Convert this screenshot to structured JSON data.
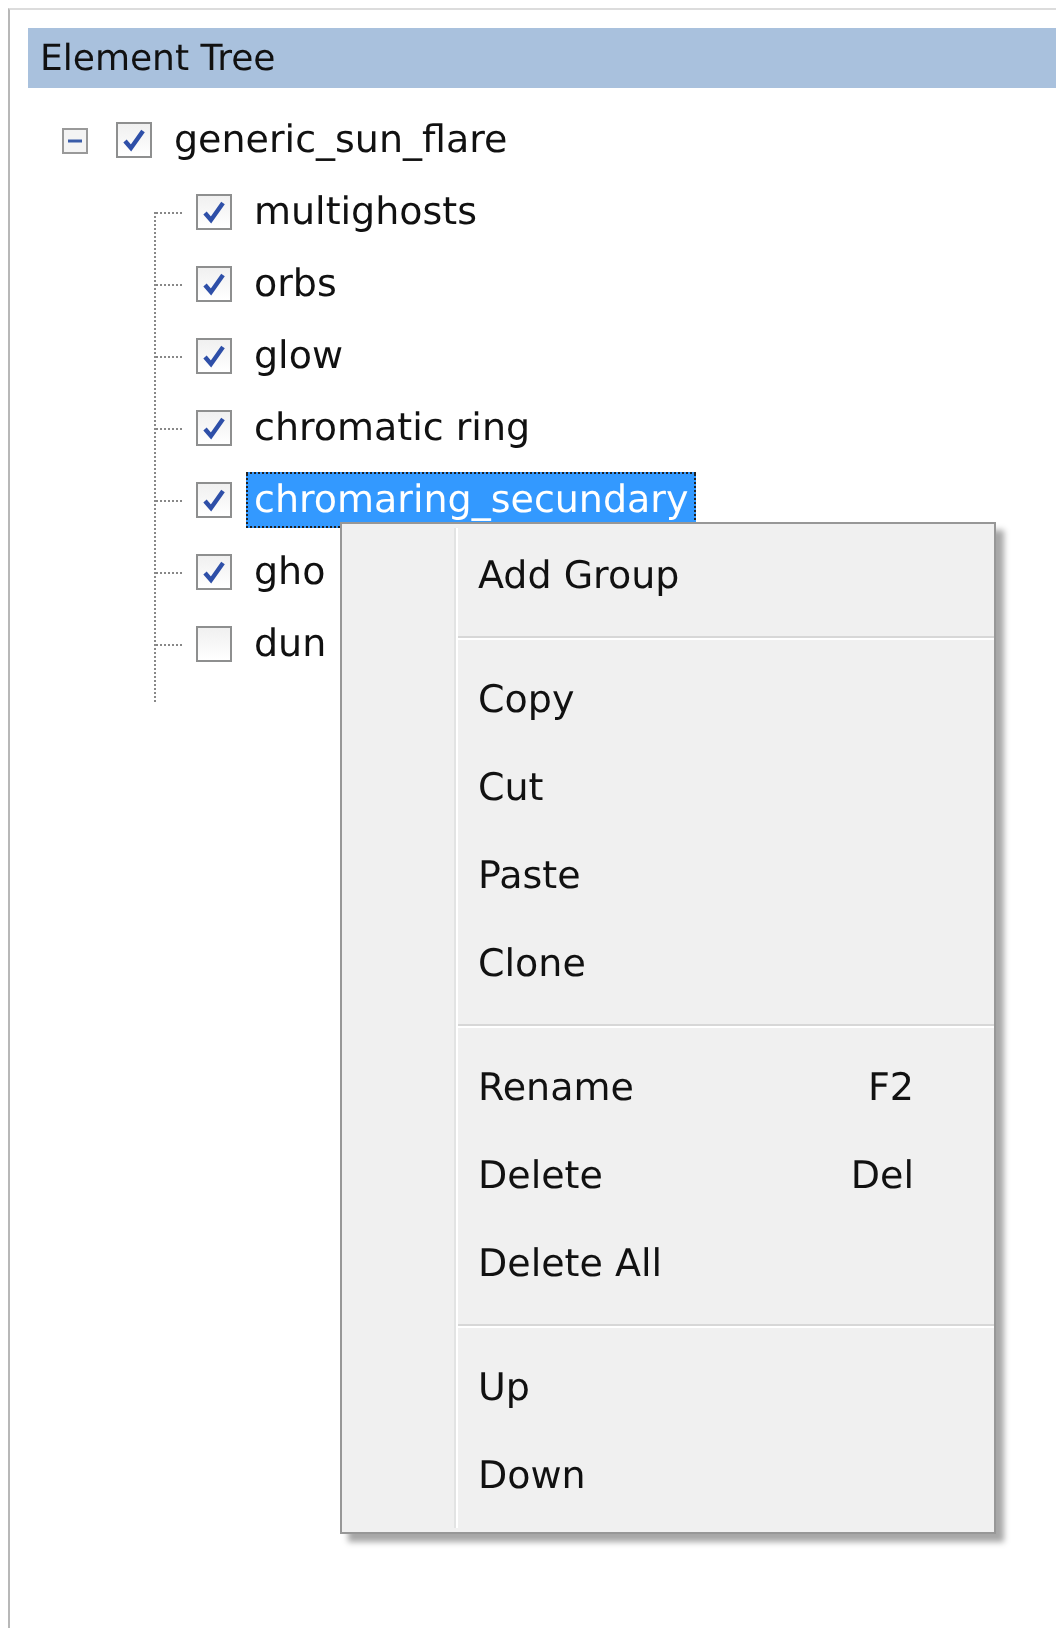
{
  "panel": {
    "title": "Element Tree"
  },
  "tree": {
    "label": "generic_sun_flare",
    "checked": true,
    "expanded": true,
    "selected": false,
    "children": [
      {
        "label": "multighosts",
        "checked": true,
        "selected": false
      },
      {
        "label": "orbs",
        "checked": true,
        "selected": false
      },
      {
        "label": "glow",
        "checked": true,
        "selected": false
      },
      {
        "label": "chromatic ring",
        "checked": true,
        "selected": false
      },
      {
        "label": "chromaring_secundary",
        "checked": true,
        "selected": true
      },
      {
        "label": "gho",
        "checked": true,
        "selected": false
      },
      {
        "label": "dun",
        "checked": false,
        "selected": false
      }
    ]
  },
  "context_menu": [
    {
      "kind": "item",
      "label": "Add Group"
    },
    {
      "kind": "separator"
    },
    {
      "kind": "item",
      "label": "Copy"
    },
    {
      "kind": "item",
      "label": "Cut"
    },
    {
      "kind": "item",
      "label": "Paste"
    },
    {
      "kind": "item",
      "label": "Clone"
    },
    {
      "kind": "separator"
    },
    {
      "kind": "item",
      "label": "Rename",
      "shortcut": "F2"
    },
    {
      "kind": "item",
      "label": "Delete",
      "shortcut": "Del"
    },
    {
      "kind": "item",
      "label": "Delete All"
    },
    {
      "kind": "separator"
    },
    {
      "kind": "item",
      "label": "Up"
    },
    {
      "kind": "item",
      "label": "Down"
    }
  ]
}
